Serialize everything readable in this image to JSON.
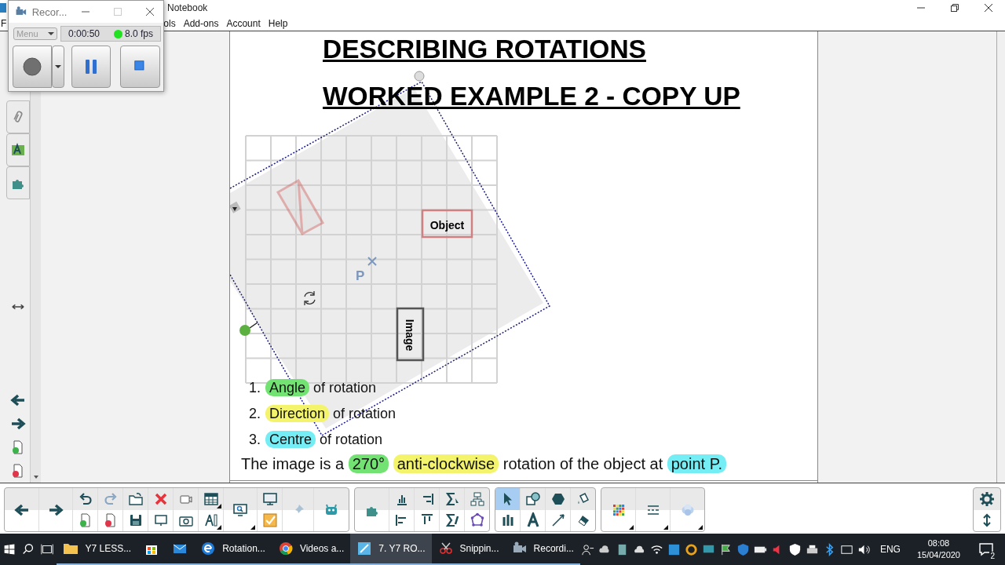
{
  "window": {
    "title": "Notebook"
  },
  "menu": [
    "F",
    "ols",
    "Add-ons",
    "Account",
    "Help"
  ],
  "recorder": {
    "title": "Recor...",
    "menu": "Menu",
    "menu_disabled": true,
    "maximize_disabled": true,
    "elapsed": "0:00:50",
    "fps": "8.0 fps"
  },
  "page": {
    "titles": [
      "DESCRIBING ROTATIONS",
      "WORKED EXAMPLE 2 - COPY UP"
    ],
    "diagram": {
      "object_label": "Object",
      "image_label": "Image",
      "point_label": "P"
    },
    "steps": [
      {
        "number": "1.",
        "highlight": "Angle",
        "rest": "of rotation",
        "color": "#72e272"
      },
      {
        "number": "2.",
        "highlight": "Direction",
        "rest": "of rotation",
        "color": "#f4f46c"
      },
      {
        "number": "3.",
        "highlight": "Centre",
        "rest": "of rotation",
        "color": "#74eef4"
      }
    ],
    "summary": [
      {
        "text": "The image is a"
      },
      {
        "text": "270°",
        "color": "#72e272"
      },
      {
        "text": "anti-clockwise",
        "color": "#f4f46c"
      },
      {
        "text": "rotation of the object at"
      },
      {
        "text": "point P.",
        "color": "#74eef4"
      }
    ]
  },
  "drawing_tools": [
    {
      "selected": true
    },
    {
      "selected": false
    },
    {
      "selected": false
    },
    {
      "selected": false
    },
    {
      "selected": false
    },
    {
      "selected": false
    },
    {
      "selected": false
    },
    {
      "selected": false
    }
  ],
  "taskbar": {
    "apps": [
      {
        "kind": "folder",
        "label": "Y7 LESS...",
        "selected": false
      },
      {
        "kind": "store",
        "selected": false
      },
      {
        "kind": "mail",
        "selected": false
      },
      {
        "kind": "edge",
        "label": "Rotation...",
        "selected": false
      },
      {
        "kind": "chrome",
        "label": "Videos a...",
        "selected": false
      },
      {
        "kind": "notebook",
        "label": "7. Y7 RO...",
        "selected": true
      },
      {
        "kind": "snip",
        "label": "Snippin...",
        "selected": false
      },
      {
        "kind": "recorder",
        "label": "Recordi...",
        "selected": false
      }
    ],
    "language": "ENG",
    "time": "08:08",
    "date": "15/04/2020",
    "notifications": "2"
  }
}
